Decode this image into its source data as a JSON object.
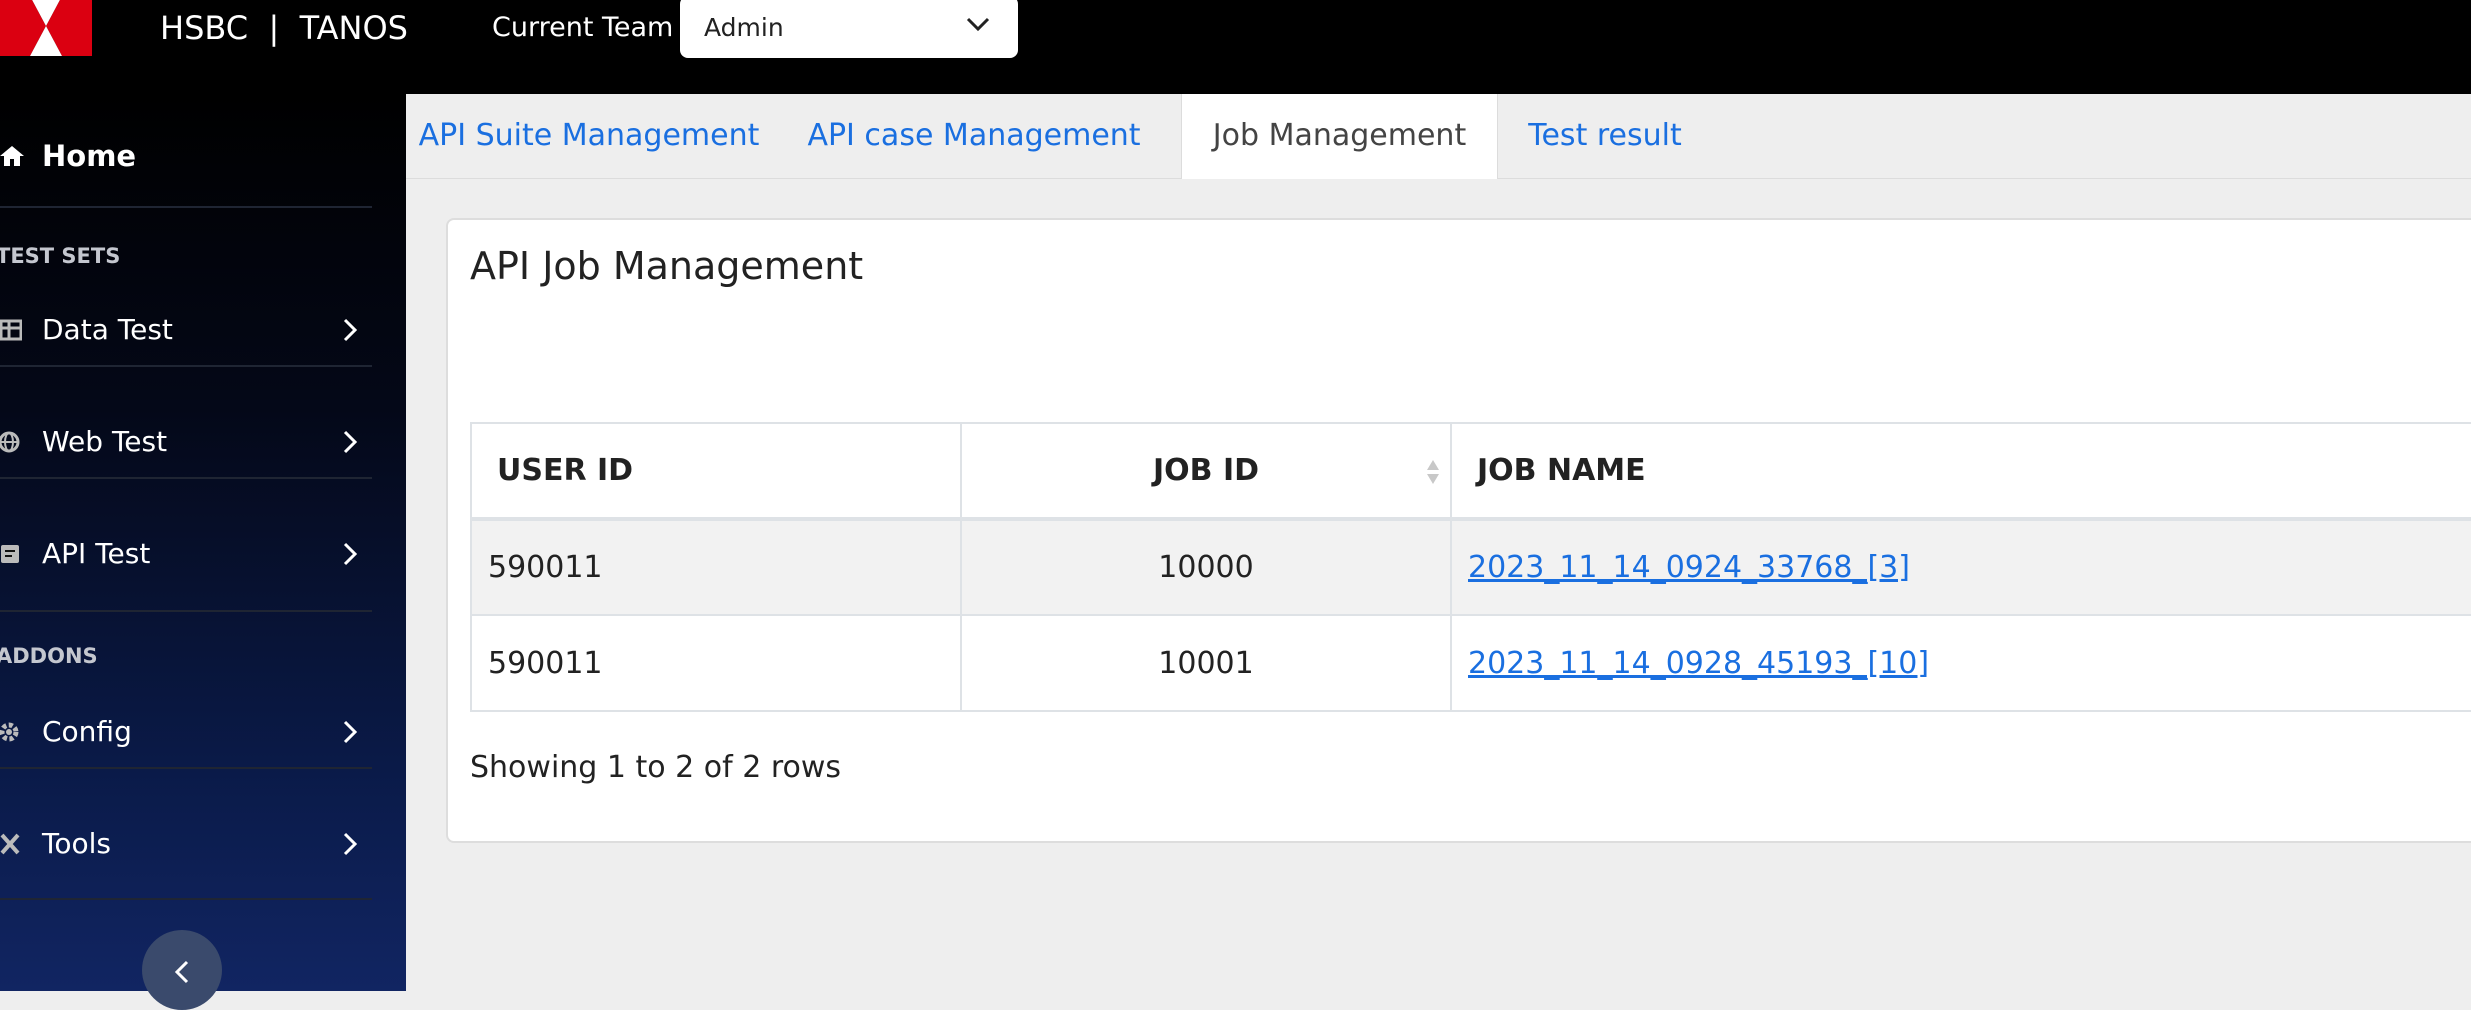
{
  "header": {
    "brand": "HSBC  |  TANOS",
    "team_label": "Current Team",
    "team_value": "Admin",
    "logo": "hsbc-hexagon-logo",
    "colors": {
      "bar": "#000000",
      "logo_red": "#db0011"
    }
  },
  "sidebar": {
    "home_label": "Home",
    "sections": [
      {
        "title": "TEST SETS",
        "items": [
          {
            "label": "Data Test",
            "icon": "table-icon"
          },
          {
            "label": "Web Test",
            "icon": "globe-icon"
          },
          {
            "label": "API Test",
            "icon": "api-doc-icon"
          }
        ]
      },
      {
        "title": "ADDONS",
        "items": [
          {
            "label": "Config",
            "icon": "gear-icon"
          },
          {
            "label": "Tools",
            "icon": "tools-icon"
          }
        ]
      }
    ],
    "collapse_icon": "chevron-left-icon"
  },
  "tabs": [
    {
      "label": "API Suite Management",
      "active": false
    },
    {
      "label": "API case Management",
      "active": false
    },
    {
      "label": "Job Management",
      "active": true
    },
    {
      "label": "Test result",
      "active": false
    }
  ],
  "card": {
    "title": "API Job Management",
    "table": {
      "columns": [
        "USER ID",
        "JOB ID",
        "JOB NAME"
      ],
      "rows": [
        {
          "user_id": "590011",
          "job_id": "10000",
          "job_name": "2023_11_14_0924_33768_[3]"
        },
        {
          "user_id": "590011",
          "job_id": "10001",
          "job_name": "2023_11_14_0928_45193_[10]"
        }
      ]
    },
    "footer": "Showing 1 to 2 of 2 rows"
  },
  "colors": {
    "link": "#1a6fe0",
    "page_bg": "#eeeeee"
  }
}
